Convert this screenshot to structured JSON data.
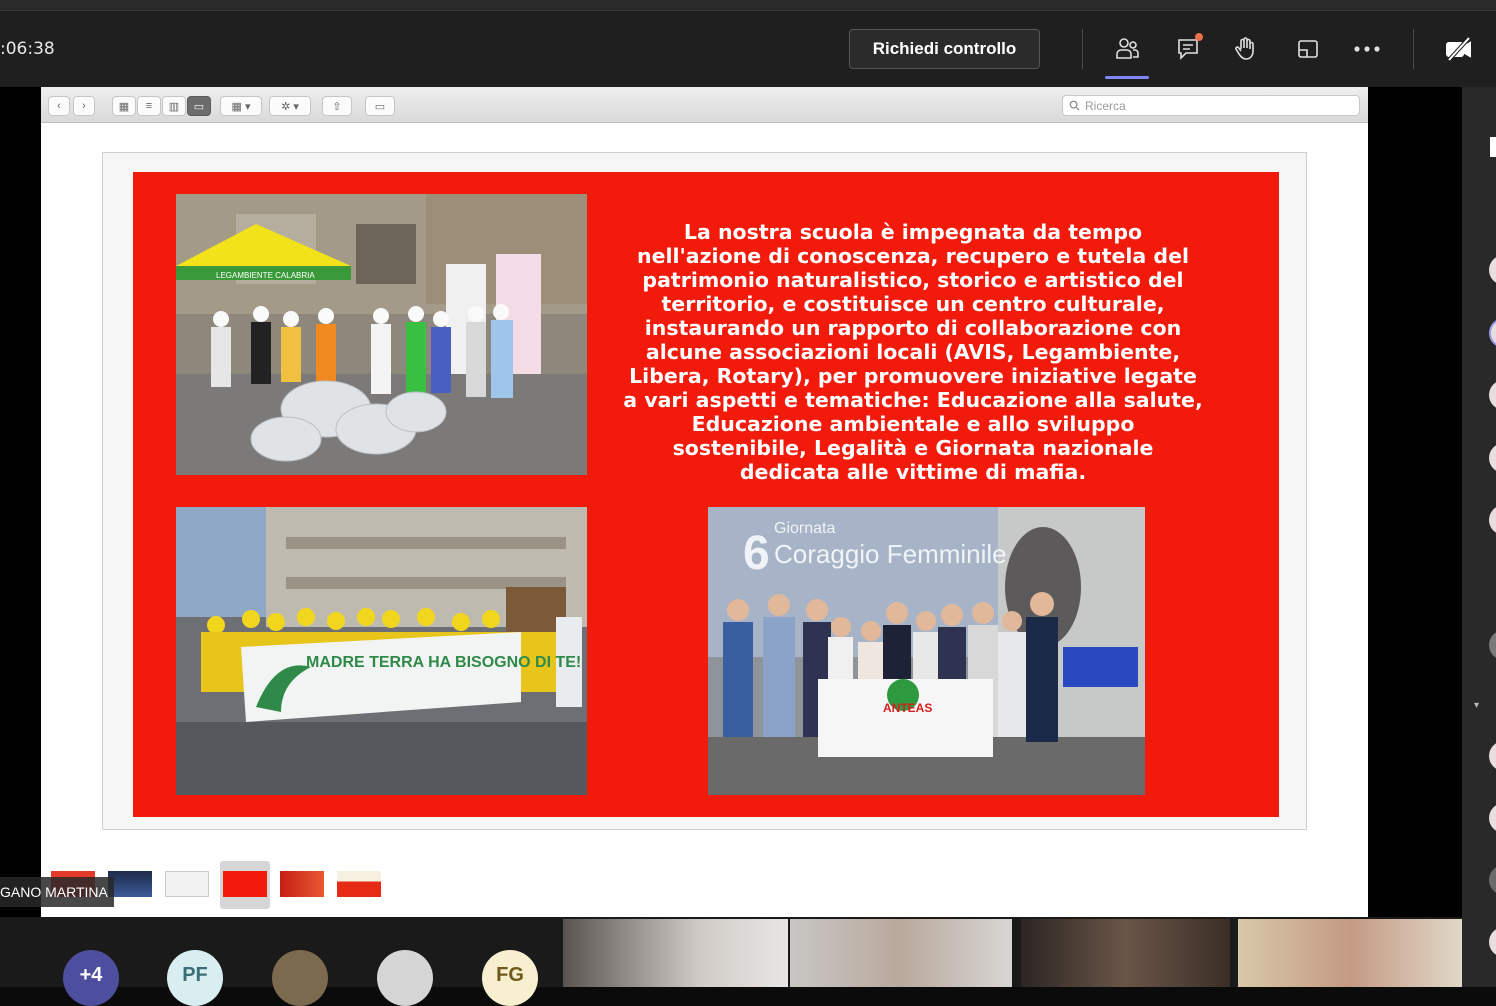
{
  "meeting": {
    "timer": ":06:38",
    "request_control_label": "Richiedi controllo"
  },
  "toolbar_icons": [
    "participants-icon",
    "chat-icon",
    "raise-hand-icon",
    "share-tray-icon",
    "more-options-icon",
    "camera-off-icon"
  ],
  "finder": {
    "search_placeholder": "Ricerca"
  },
  "slide": {
    "text": "La nostra scuola è impegnata da tempo nell'azione di conoscenza, recupero e tutela del patrimonio naturalistico, storico e artistico del territorio, e costituisce un centro culturale, instaurando un rapporto di collaborazione con alcune associazioni locali (AVIS, Legambiente, Libera, Rotary), per promuovere iniziative legate a vari aspetti e tematiche: Educazione alla salute, Educazione ambientale e allo sviluppo sostenibile, Legalità e Giornata nazionale dedicata alle vittime di mafia.",
    "tent_text": "LEGAMBIENTE CALABRIA",
    "banner_text": "MADRE TERRA HA BISOGNO DI TE!",
    "event_title_number": "6",
    "event_title_a": "Giornata",
    "event_title_b": "Coraggio Femminile",
    "sign_text": "ANTEAS"
  },
  "presenter_name": "GANO MARTINA",
  "participants": {
    "overflow": "+4",
    "initials_pf": "PF",
    "initials_fg": "FG"
  },
  "colors": {
    "slide_red": "#f21a0a",
    "accent": "#7f85f5"
  }
}
